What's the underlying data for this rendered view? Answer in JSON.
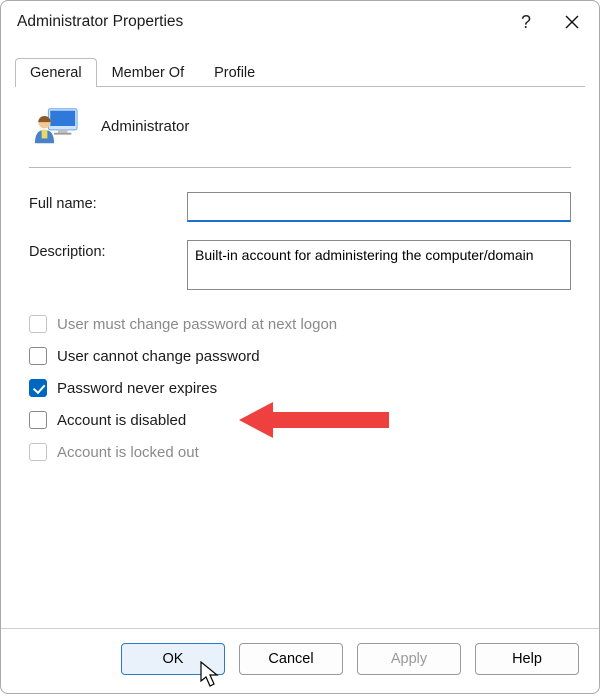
{
  "window": {
    "title": "Administrator Properties"
  },
  "tabs": {
    "general": "General",
    "member_of": "Member Of",
    "profile": "Profile"
  },
  "user": {
    "display_name": "Administrator"
  },
  "form": {
    "full_name_label": "Full name:",
    "full_name_value": "",
    "description_label": "Description:",
    "description_value": "Built-in account for administering the computer/domain"
  },
  "checks": {
    "must_change": {
      "label": "User must change password at next logon",
      "checked": false,
      "enabled": false
    },
    "cannot_change": {
      "label": "User cannot change password",
      "checked": false,
      "enabled": true
    },
    "never_expires": {
      "label": "Password never expires",
      "checked": true,
      "enabled": true
    },
    "disabled": {
      "label": "Account is disabled",
      "checked": false,
      "enabled": true
    },
    "locked_out": {
      "label": "Account is locked out",
      "checked": false,
      "enabled": false
    }
  },
  "buttons": {
    "ok": "OK",
    "cancel": "Cancel",
    "apply": "Apply",
    "help": "Help"
  }
}
